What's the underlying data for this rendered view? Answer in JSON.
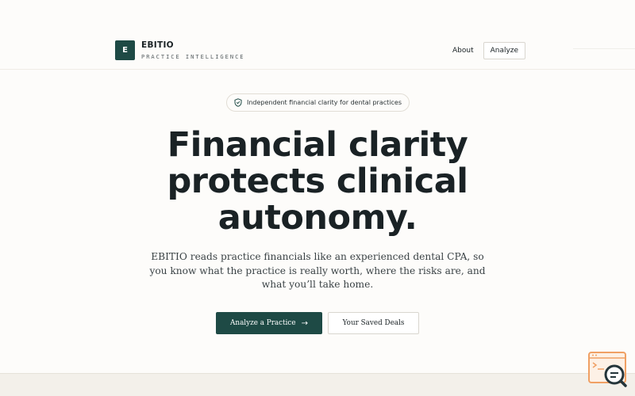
{
  "brand": {
    "logo_letter": "E",
    "name": "EBITIO",
    "tagline": "PRACTICE INTELLIGENCE"
  },
  "nav": {
    "about": "About",
    "analyze": "Analyze"
  },
  "hero": {
    "badge_icon": "shield-check-icon",
    "badge_text": "Independent financial clarity for dental practices",
    "headline_line1": "Financial clarity",
    "headline_line2": "protects clinical",
    "headline_line3": "autonomy.",
    "subcopy": "EBITIO reads practice financials like an experienced dental CPA, so you know what the practice is really worth, where the risks are, and what you’ll take home."
  },
  "cta": {
    "primary_label": "Analyze a Practice",
    "primary_icon": "arrow-right-icon",
    "secondary_label": "Your Saved Deals"
  },
  "colors": {
    "brand": "#1e4a45",
    "background": "#fdfcfa",
    "text": "#1a2225",
    "widget_accent": "#f0a064"
  },
  "widget": {
    "icon": "search-chat-widget-icon"
  }
}
